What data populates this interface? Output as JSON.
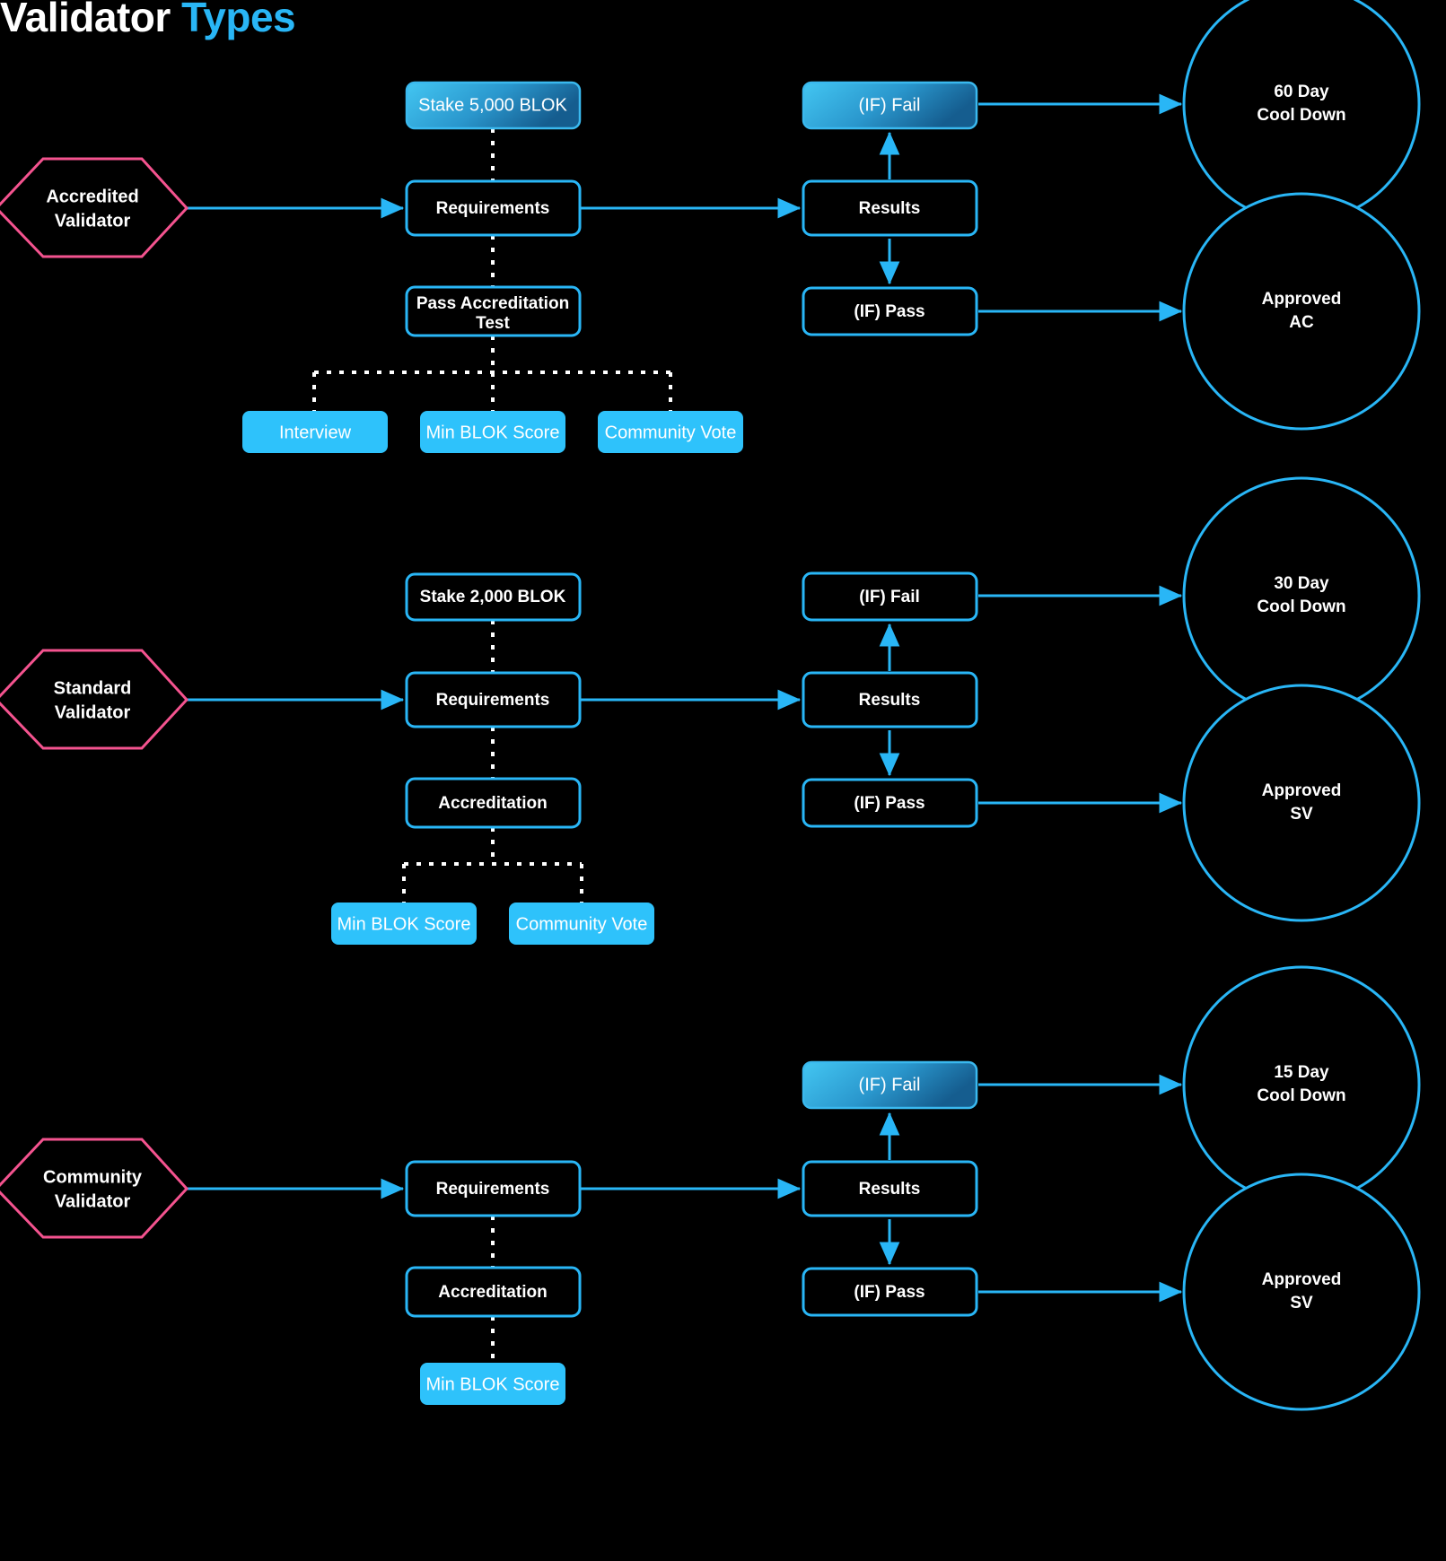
{
  "title": {
    "word1": "Validator",
    "word2": "Types"
  },
  "colors": {
    "background": "#000000",
    "accent_cyan": "#29b6f6",
    "light_blue_fill": "#2ec2fb",
    "hexagon_pink": "#f4538f",
    "dotted_white": "#ffffff",
    "gradient_from": "#3fc3f0",
    "gradient_to": "#1b6fa8"
  },
  "sections": [
    {
      "id": "accredited",
      "source": {
        "label_line1": "Accredited",
        "label_line2": "Validator"
      },
      "requirements": {
        "label": "Requirements"
      },
      "stake": {
        "label": "Stake 5,000 BLOK",
        "style": "gradient"
      },
      "accreditation": {
        "label_line1": "Pass Accreditation",
        "label_line2": "Test"
      },
      "criteria": [
        {
          "label": "Interview"
        },
        {
          "label": "Min BLOK Score"
        },
        {
          "label": "Community Vote"
        }
      ],
      "results": {
        "label": "Results"
      },
      "fail": {
        "label": "(IF) Fail",
        "style": "gradient"
      },
      "pass": {
        "label": "(IF) Pass",
        "style": "outline"
      },
      "fail_outcome": {
        "label_line1": "60 Day",
        "label_line2": "Cool Down"
      },
      "pass_outcome": {
        "label_line1": "Approved",
        "label_line2": "AC"
      }
    },
    {
      "id": "standard",
      "source": {
        "label_line1": "Standard",
        "label_line2": "Validator"
      },
      "requirements": {
        "label": "Requirements"
      },
      "stake": {
        "label": "Stake 2,000 BLOK",
        "style": "outline"
      },
      "accreditation": {
        "label_line1": "Accreditation",
        "label_line2": ""
      },
      "criteria": [
        {
          "label": "Min BLOK Score"
        },
        {
          "label": "Community Vote"
        }
      ],
      "results": {
        "label": "Results"
      },
      "fail": {
        "label": "(IF) Fail",
        "style": "outline"
      },
      "pass": {
        "label": "(IF) Pass",
        "style": "outline"
      },
      "fail_outcome": {
        "label_line1": "30 Day",
        "label_line2": "Cool Down"
      },
      "pass_outcome": {
        "label_line1": "Approved",
        "label_line2": "SV"
      }
    },
    {
      "id": "community",
      "source": {
        "label_line1": "Community",
        "label_line2": "Validator"
      },
      "requirements": {
        "label": "Requirements"
      },
      "stake": {
        "label": "",
        "style": "none"
      },
      "accreditation": {
        "label_line1": "Accreditation",
        "label_line2": ""
      },
      "criteria": [
        {
          "label": "Min BLOK Score"
        }
      ],
      "results": {
        "label": "Results"
      },
      "fail": {
        "label": "(IF) Fail",
        "style": "gradient"
      },
      "pass": {
        "label": "(IF) Pass",
        "style": "outline"
      },
      "fail_outcome": {
        "label_line1": "15 Day",
        "label_line2": "Cool Down"
      },
      "pass_outcome": {
        "label_line1": "Approved",
        "label_line2": "SV"
      }
    }
  ]
}
